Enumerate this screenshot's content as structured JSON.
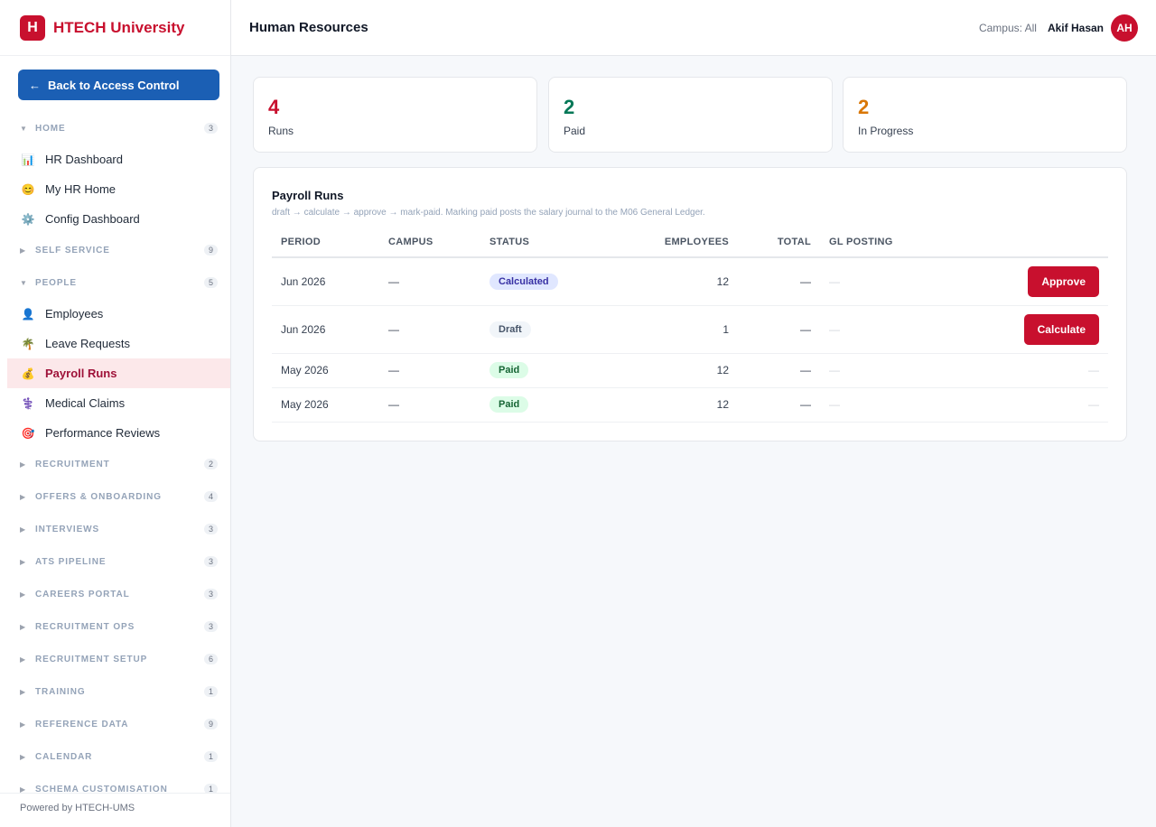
{
  "brand": {
    "logo_letter": "H",
    "name": "HTECH University",
    "color": "#c8102e"
  },
  "back_button": {
    "arrow": "←",
    "label": "Back to Access Control"
  },
  "sidebar": {
    "home": {
      "label": "HOME",
      "count": "3"
    },
    "home_items": [
      {
        "icon": "📊",
        "label": "HR Dashboard"
      },
      {
        "icon": "😊",
        "label": "My HR Home"
      },
      {
        "icon": "⚙️",
        "label": "Config Dashboard"
      }
    ],
    "self_service": {
      "label": "SELF SERVICE",
      "count": "9"
    },
    "people": {
      "label": "PEOPLE",
      "count": "5"
    },
    "people_items": [
      {
        "icon": "👤",
        "label": "Employees"
      },
      {
        "icon": "🌴",
        "label": "Leave Requests"
      },
      {
        "icon": "💰",
        "label": "Payroll Runs"
      },
      {
        "icon": "⚕️",
        "label": "Medical Claims"
      },
      {
        "icon": "🎯",
        "label": "Performance Reviews"
      }
    ],
    "collapsed_sections": [
      {
        "label": "RECRUITMENT",
        "count": "2"
      },
      {
        "label": "OFFERS & ONBOARDING",
        "count": "4"
      },
      {
        "label": "INTERVIEWS",
        "count": "3"
      },
      {
        "label": "ATS PIPELINE",
        "count": "3"
      },
      {
        "label": "CAREERS PORTAL",
        "count": "3"
      },
      {
        "label": "RECRUITMENT OPS",
        "count": "3"
      },
      {
        "label": "RECRUITMENT SETUP",
        "count": "6"
      },
      {
        "label": "TRAINING",
        "count": "1"
      },
      {
        "label": "REFERENCE DATA",
        "count": "9"
      },
      {
        "label": "CALENDAR",
        "count": "1"
      },
      {
        "label": "SCHEMA CUSTOMISATION",
        "count": "1"
      }
    ],
    "footer": "Powered by HTECH-UMS"
  },
  "header": {
    "title": "Human Resources",
    "campus": "Campus: All",
    "user_name": "Akif Hasan",
    "user_initials": "AH"
  },
  "stats": [
    {
      "value": "4",
      "label": "Runs",
      "color": "#c8102e"
    },
    {
      "value": "2",
      "label": "Paid",
      "color": "#047857"
    },
    {
      "value": "2",
      "label": "In Progress",
      "color": "#d97706"
    }
  ],
  "payroll": {
    "title": "Payroll Runs",
    "description": "draft → calculate → approve → mark-paid. Marking paid posts the salary journal to the M06 General Ledger.",
    "columns": {
      "period": "PERIOD",
      "campus": "CAMPUS",
      "status": "STATUS",
      "employees": "EMPLOYEES",
      "total": "TOTAL",
      "gl_posting": "GL POSTING"
    },
    "rows": [
      {
        "period": "Jun 2026",
        "campus": "—",
        "status": "Calculated",
        "employees": "12",
        "total": "—",
        "gl_posting": "—",
        "action": "Approve"
      },
      {
        "period": "Jun 2026",
        "campus": "—",
        "status": "Draft",
        "employees": "1",
        "total": "—",
        "gl_posting": "—",
        "action": "Calculate"
      },
      {
        "period": "May 2026",
        "campus": "—",
        "status": "Paid",
        "employees": "12",
        "total": "—",
        "gl_posting": "—",
        "action": "—"
      },
      {
        "period": "May 2026",
        "campus": "—",
        "status": "Paid",
        "employees": "12",
        "total": "—",
        "gl_posting": "—",
        "action": "—"
      }
    ],
    "status_colors": {
      "Calculated": {
        "bg": "#e0e7ff",
        "fg": "#3730a3"
      },
      "Draft": {
        "bg": "#f1f5f9",
        "fg": "#475569"
      },
      "Paid": {
        "bg": "#dcfce7",
        "fg": "#166534"
      }
    }
  }
}
